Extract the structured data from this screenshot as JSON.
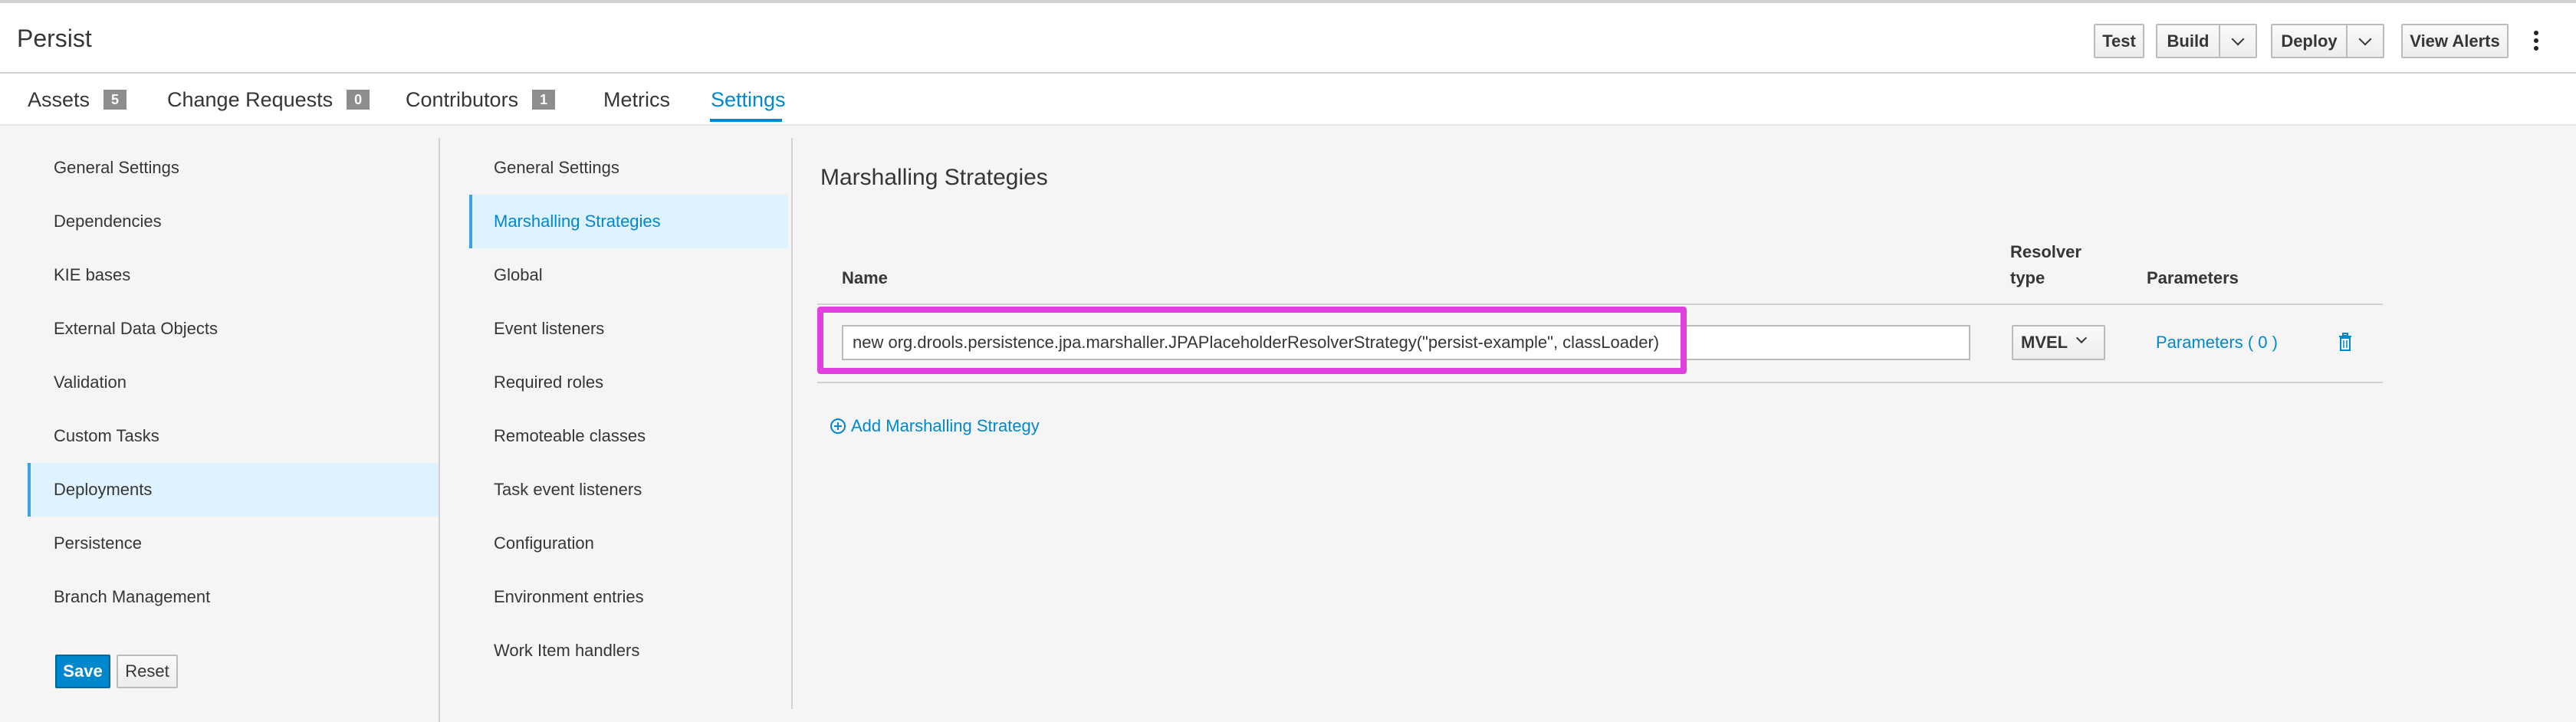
{
  "header": {
    "title": "Persist",
    "buttons": {
      "test": "Test",
      "build": "Build",
      "deploy": "Deploy",
      "view_alerts": "View Alerts"
    }
  },
  "tabs": {
    "assets": {
      "label": "Assets",
      "count": "5"
    },
    "change_requests": {
      "label": "Change Requests",
      "count": "0"
    },
    "contributors": {
      "label": "Contributors",
      "count": "1"
    },
    "metrics": {
      "label": "Metrics"
    },
    "settings": {
      "label": "Settings"
    }
  },
  "settings_nav": {
    "items": [
      "General Settings",
      "Dependencies",
      "KIE bases",
      "External Data Objects",
      "Validation",
      "Custom Tasks",
      "Deployments",
      "Persistence",
      "Branch Management"
    ],
    "active": "Deployments",
    "save_label": "Save",
    "reset_label": "Reset"
  },
  "deployments_nav": {
    "items": [
      "General Settings",
      "Marshalling Strategies",
      "Global",
      "Event listeners",
      "Required roles",
      "Remoteable classes",
      "Task event listeners",
      "Configuration",
      "Environment entries",
      "Work Item handlers"
    ],
    "active": "Marshalling Strategies"
  },
  "main": {
    "title": "Marshalling Strategies",
    "columns": {
      "name": "Name",
      "resolver_line1": "Resolver",
      "resolver_line2": "type",
      "parameters": "Parameters"
    },
    "rows": [
      {
        "name": "new org.drools.persistence.jpa.marshaller.JPAPlaceholderResolverStrategy(\"persist-example\", classLoader)",
        "resolver": "MVEL",
        "parameters": "Parameters ( 0 )"
      }
    ],
    "add_label": "Add Marshalling Strategy"
  },
  "colors": {
    "accent": "#0088ce",
    "highlight": "#e040e0",
    "active_bg": "#def3ff"
  },
  "icons": [
    "chevron-down-icon",
    "kebab-menu-icon",
    "trash-icon",
    "add-circle-icon"
  ]
}
